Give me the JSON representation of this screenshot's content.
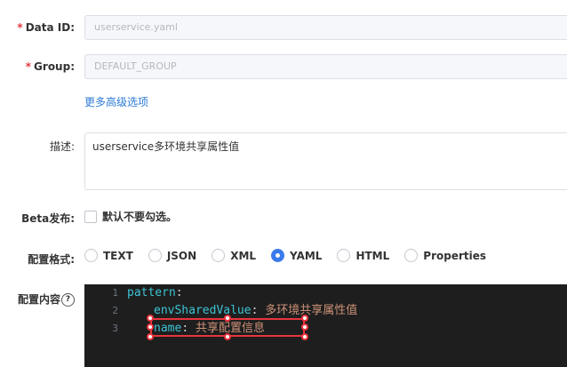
{
  "form": {
    "data_id": {
      "label": "Data ID:",
      "value": "userservice.yaml",
      "required": true
    },
    "group": {
      "label": "Group:",
      "value": "DEFAULT_GROUP",
      "required": true
    },
    "advanced_link": "更多高级选项",
    "description": {
      "label": "描述:",
      "value": "userservice多环境共享属性值"
    },
    "beta": {
      "label": "Beta发布:",
      "checkbox_label": "默认不要勾选。",
      "checked": false
    },
    "format": {
      "label": "配置格式:",
      "options": [
        "TEXT",
        "JSON",
        "XML",
        "YAML",
        "HTML",
        "Properties"
      ],
      "selected": "YAML"
    },
    "content": {
      "label": "配置内容",
      "help_glyph": "?"
    }
  },
  "editor": {
    "lines": [
      {
        "num": "1",
        "key": "pattern",
        "sep": ":",
        "value": ""
      },
      {
        "num": "2",
        "key": "envSharedValue",
        "sep": ": ",
        "value": "多环境共享属性值"
      },
      {
        "num": "3",
        "key": "name",
        "sep": ": ",
        "value": "共享配置信息"
      }
    ]
  },
  "colors": {
    "accent": "#3a7bec",
    "required": "#e4393c",
    "editor_bg": "#1e1e1e",
    "key": "#3cc4d4",
    "string": "#ce9178",
    "annotation": "#e8343c"
  }
}
